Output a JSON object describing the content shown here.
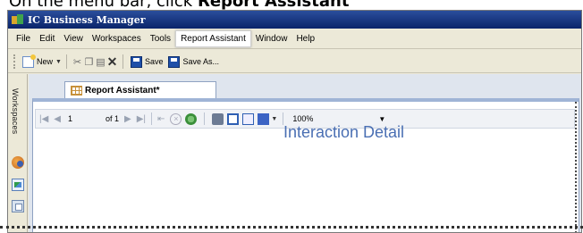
{
  "instruction": {
    "prefix": "On the menu bar, click ",
    "target": "Report Assistant"
  },
  "window": {
    "title": "IC Business Manager"
  },
  "menubar": {
    "items": [
      "File",
      "Edit",
      "View",
      "Workspaces",
      "Tools",
      "Report Assistant",
      "Window",
      "Help"
    ],
    "active": "Report Assistant"
  },
  "toolbar": {
    "new_label": "New",
    "save_label": "Save",
    "save_as_label": "Save As..."
  },
  "sidebar": {
    "label": "Workspaces"
  },
  "tab": {
    "label": "Report Assistant*"
  },
  "report_toolbar": {
    "page_current": "1",
    "page_of": "of 1",
    "zoom": "100%"
  },
  "report": {
    "title": "Interaction Detail"
  }
}
